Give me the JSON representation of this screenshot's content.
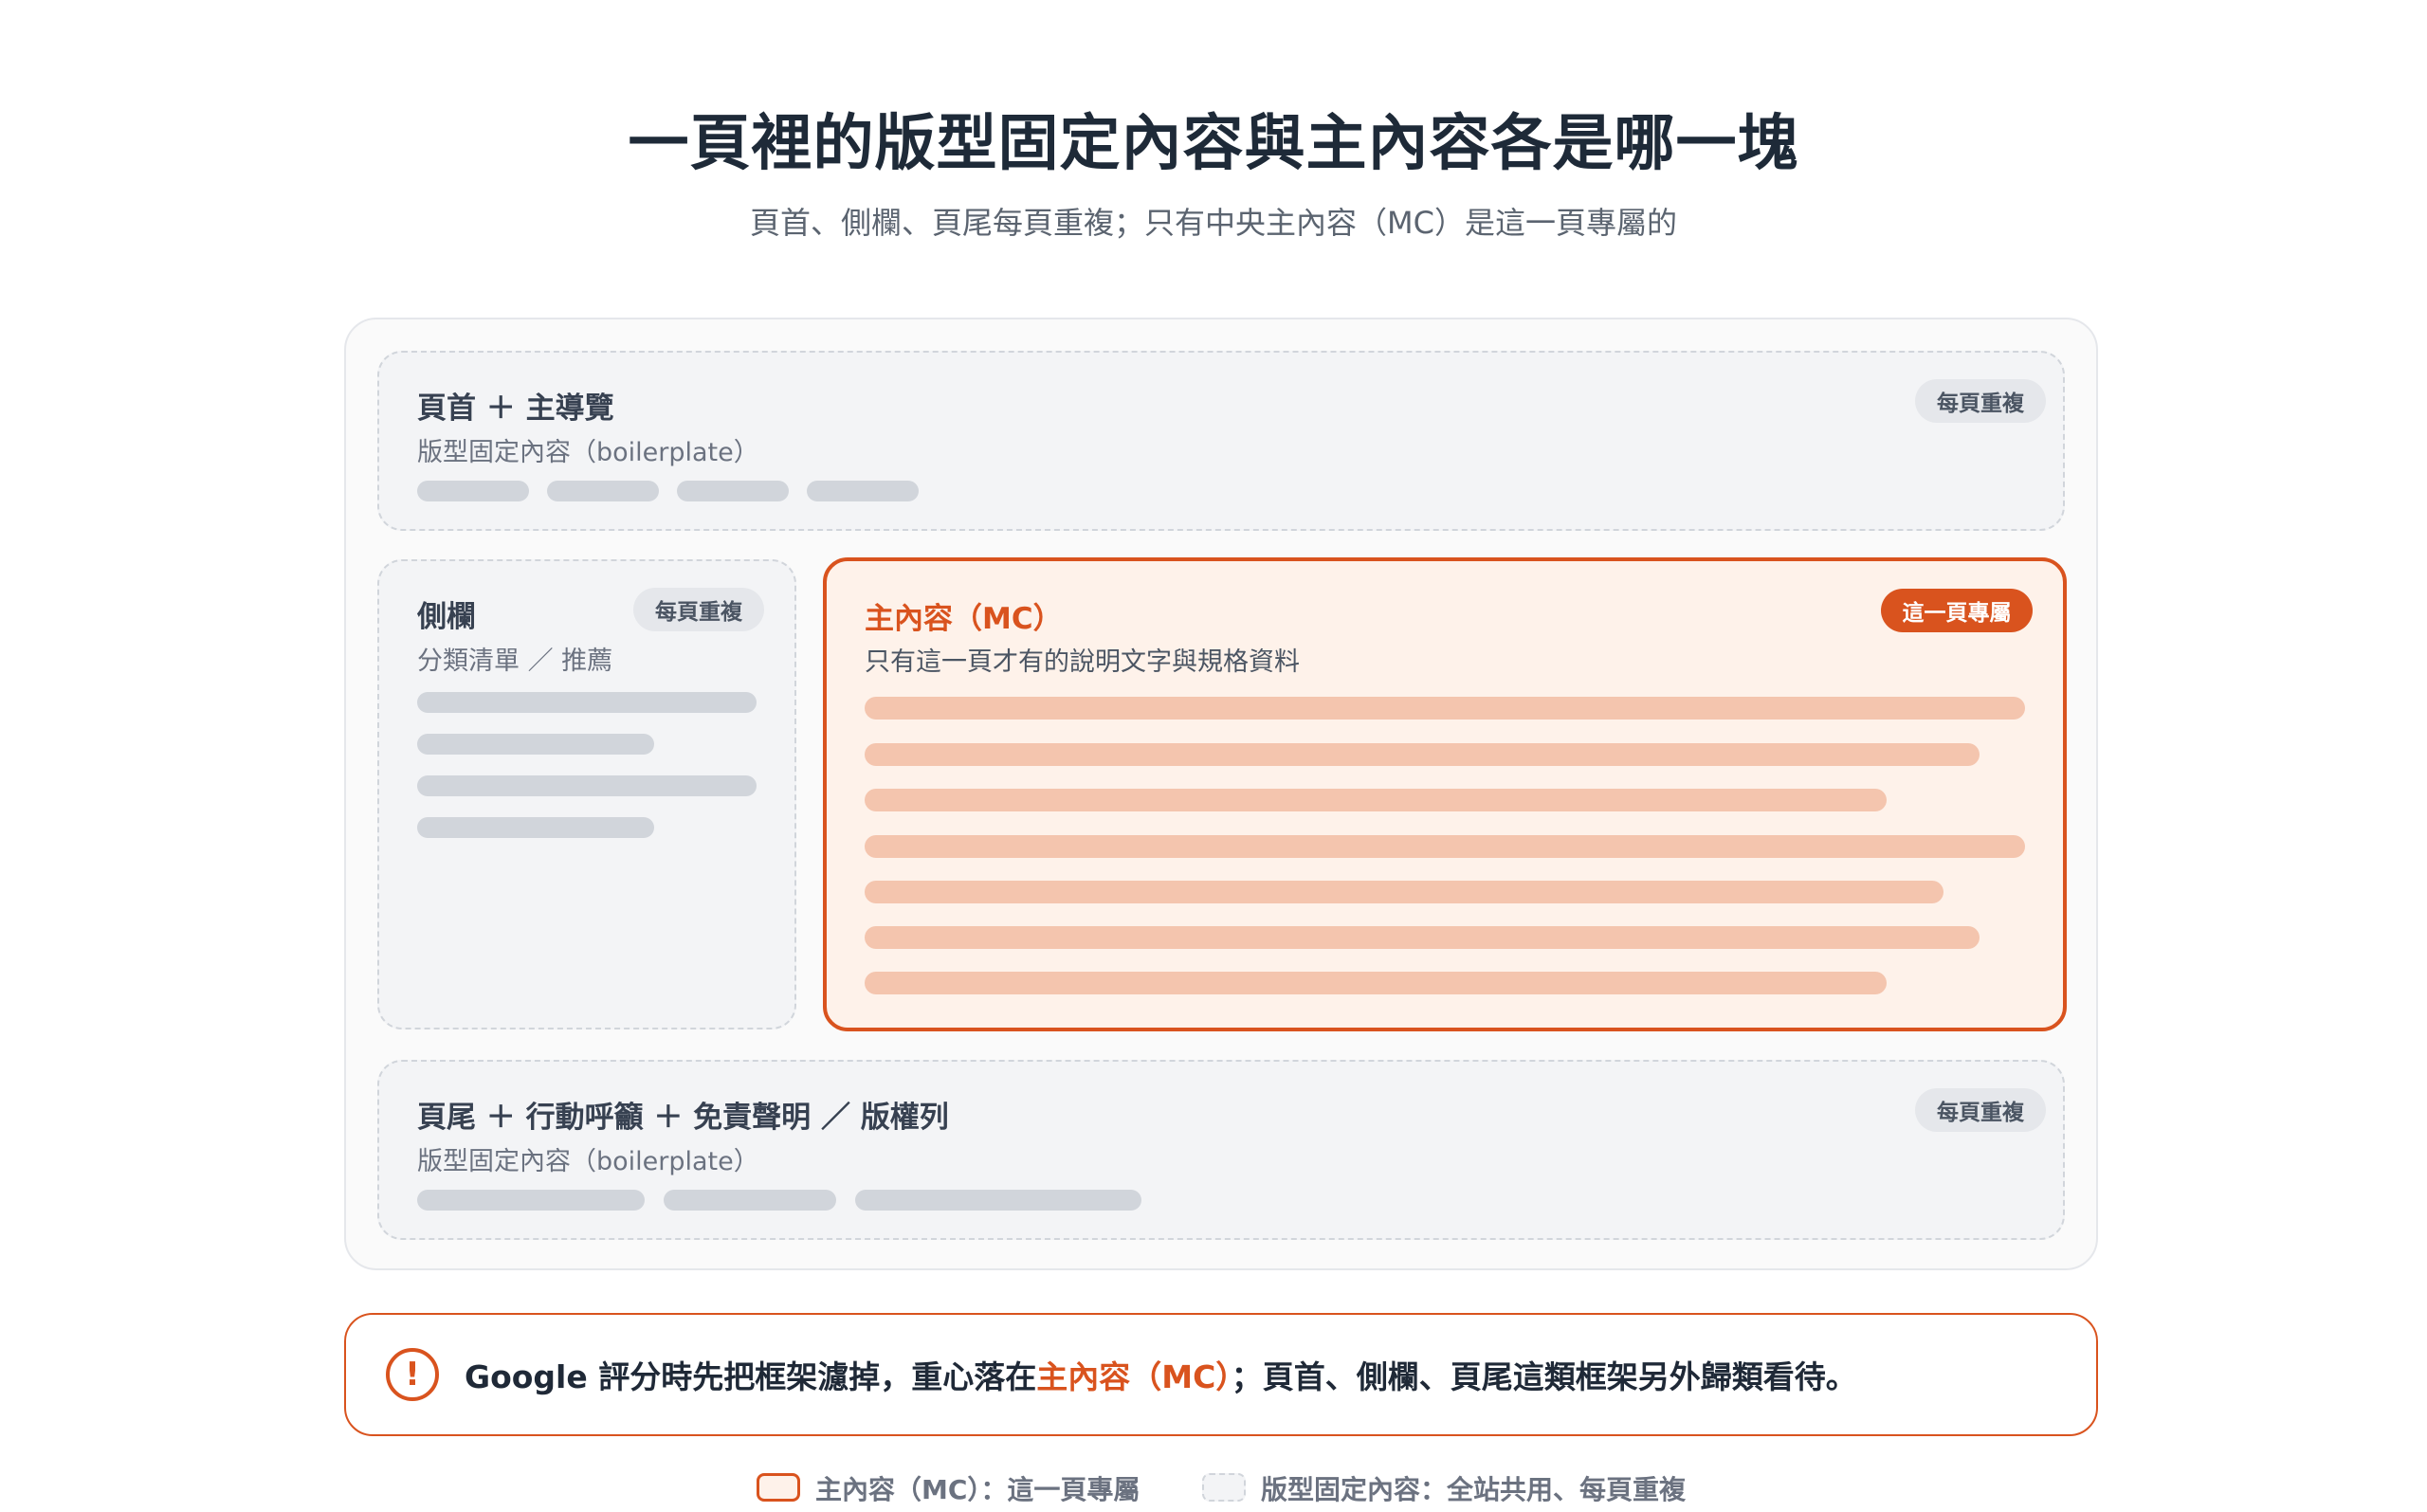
{
  "title": "一頁裡的版型固定內容與主內容各是哪一塊",
  "subtitle": "頁首、側欄、頁尾每頁重複；只有中央主內容（MC）是這一頁專屬的",
  "header_box": {
    "title": "頁首 ＋ 主導覽",
    "sub": "版型固定內容（boilerplate）",
    "badge": "每頁重複"
  },
  "sidebar_box": {
    "title": "側欄",
    "sub": "分類清單 ／ 推薦",
    "badge": "每頁重複"
  },
  "main_box": {
    "title": "主內容（MC）",
    "sub": "只有這一頁才有的說明文字與規格資料",
    "badge": "這一頁專屬"
  },
  "footer_box": {
    "title": "頁尾 ＋ 行動呼籲 ＋ 免責聲明 ／ 版權列",
    "sub": "版型固定內容（boilerplate）",
    "badge": "每頁重複"
  },
  "callout": {
    "icon": "alert-circle-icon",
    "text_before": "Google 評分時先把框架濾掉，重心落在",
    "text_accent": "主內容（MC）",
    "text_after": "；頁首、側欄、頁尾這類框架另外歸類看待。"
  },
  "legend": {
    "mc": "主內容（MC）：這一頁專屬",
    "boilerplate": "版型固定內容：全站共用、每頁重複"
  },
  "colors": {
    "accent": "#d9531e",
    "accent_bg": "#fef2ea",
    "placeholder_gray": "#d1d5db",
    "placeholder_peach": "#f4c5ae"
  }
}
